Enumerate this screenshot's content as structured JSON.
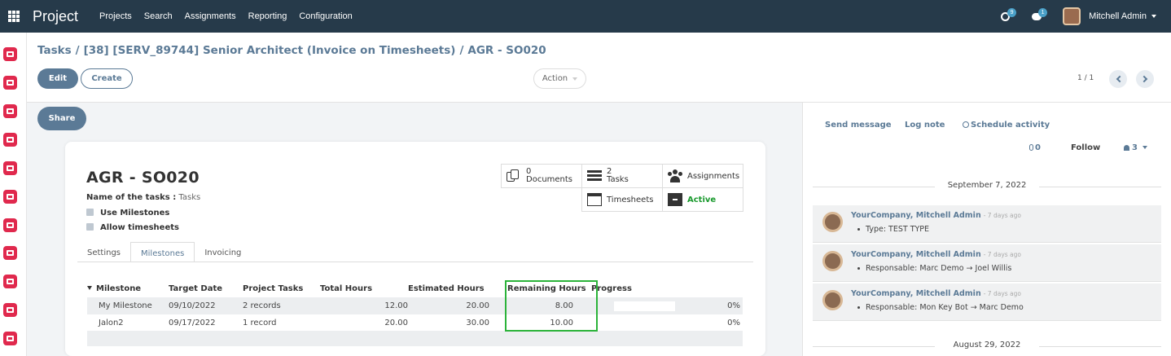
{
  "app": {
    "title": "Project"
  },
  "topmenu": [
    "Projects",
    "Search",
    "Assignments",
    "Reporting",
    "Configuration"
  ],
  "topbar": {
    "activity_count": "9",
    "message_count": "1",
    "user_name": "Mitchell Admin"
  },
  "rail_apps": [
    "discuss-app-icon",
    "calendar-app-icon",
    "contacts-app-icon",
    "crm-app-icon",
    "sales-app-icon",
    "invoicing-app-icon",
    "website-app-icon",
    "inventory-app-icon",
    "manufacturing-app-icon",
    "accounting-app-icon",
    "documents-app-icon",
    "timesheets-app-icon"
  ],
  "breadcrumb": {
    "root": "Tasks",
    "parent": "[38] [SERV_89744] Senior Architect (Invoice on Timesheets)",
    "current": "AGR - SO020",
    "separator": "/"
  },
  "controls": {
    "edit": "Edit",
    "create": "Create",
    "action": "Action",
    "pager": "1 / 1",
    "share": "Share"
  },
  "record": {
    "title": "AGR - SO020",
    "name_label": "Name of the tasks :",
    "name_value": "Tasks",
    "use_milestones": "Use Milestones",
    "allow_timesheets": "Allow timesheets"
  },
  "stat_buttons": {
    "documents_count": "0",
    "documents_label": "Documents",
    "tasks_count": "2",
    "tasks_label": "Tasks",
    "assignments_label": "Assignments",
    "timesheets_label": "Timesheets",
    "active_label": "Active"
  },
  "tabs": [
    "Settings",
    "Milestones",
    "Invoicing"
  ],
  "milestones_table": {
    "headers": [
      "Milestone",
      "Target Date",
      "Project Tasks",
      "Total Hours",
      "Estimated Hours",
      "Remaining Hours",
      "Progress"
    ],
    "rows": [
      {
        "milestone": "My Milestone",
        "target_date": "09/10/2022",
        "project_tasks": "2 records",
        "total_hours": "12.00",
        "estimated_hours": "20.00",
        "remaining_hours": "8.00",
        "progress": "0%"
      },
      {
        "milestone": "Jalon2",
        "target_date": "09/17/2022",
        "project_tasks": "1 record",
        "total_hours": "20.00",
        "estimated_hours": "30.00",
        "remaining_hours": "10.00",
        "progress": "0%"
      }
    ]
  },
  "chatter": {
    "send_message": "Send message",
    "log_note": "Log note",
    "schedule_activity": "Schedule activity",
    "attachments_count": "0",
    "follow": "Follow",
    "followers_count": "3",
    "date_sep_1": "September 7, 2022",
    "date_sep_2": "August 29, 2022",
    "messages": [
      {
        "author": "YourCompany, Mitchell Admin",
        "ago": "- 7 days ago",
        "body": "Type: TEST TYPE"
      },
      {
        "author": "YourCompany, Mitchell Admin",
        "ago": "- 7 days ago",
        "body": "Responsable: Marc Demo → Joel Willis"
      },
      {
        "author": "YourCompany, Mitchell Admin",
        "ago": "- 7 days ago",
        "body": "Responsable: Mon Key Bot → Marc Demo"
      }
    ]
  },
  "colors": {
    "navbar": "#263a4a",
    "primary": "#5b7a96",
    "app_icon": "#e0294d",
    "highlight": "#2bb33a",
    "active": "#1a9a2e"
  }
}
